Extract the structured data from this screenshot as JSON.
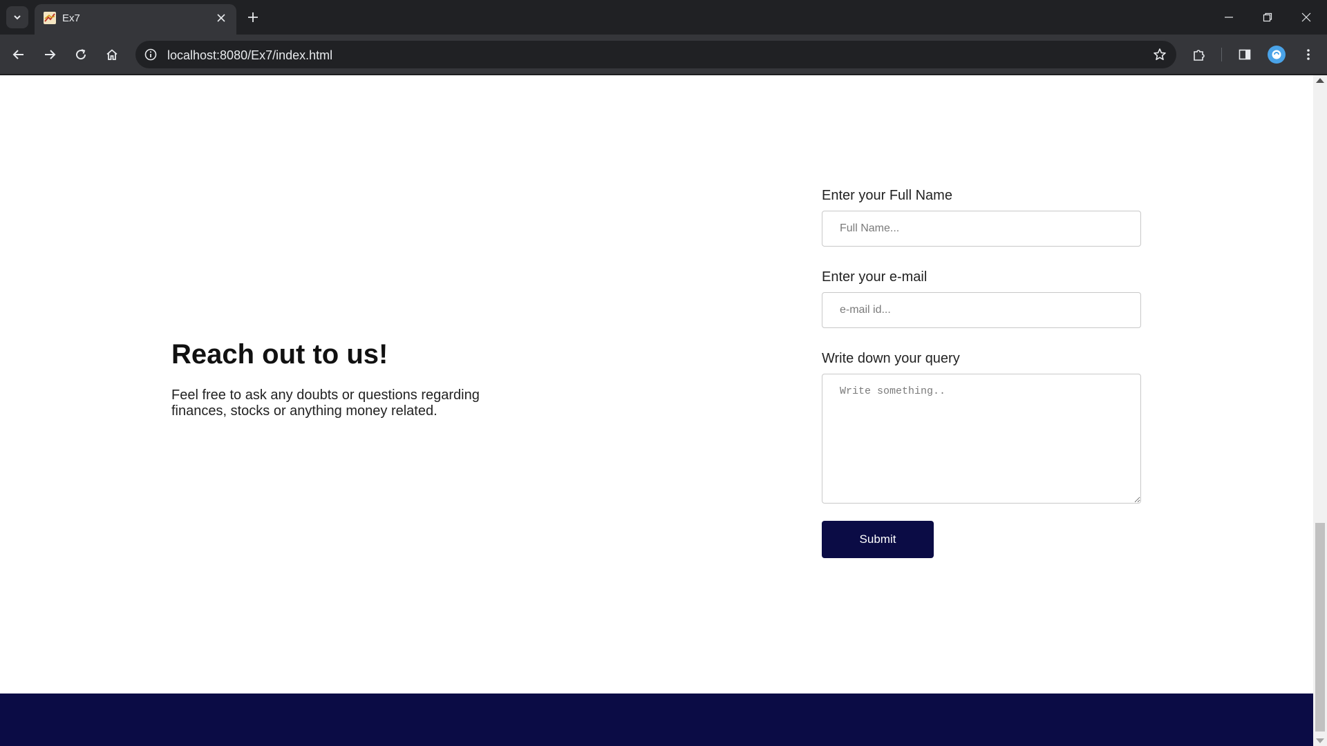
{
  "browser": {
    "tab_title": "Ex7",
    "url": "localhost:8080/Ex7/index.html"
  },
  "contact": {
    "heading": "Reach out to us!",
    "text": "Feel free to ask any doubts or questions regarding finances, stocks or anything money related."
  },
  "form": {
    "name_label": "Enter your Full Name",
    "name_placeholder": "Full Name...",
    "email_label": "Enter your e-mail",
    "email_placeholder": "e-mail id...",
    "query_label": "Write down your query",
    "query_placeholder": "Write something..",
    "submit_label": "Submit"
  },
  "colors": {
    "brand_navy": "#0b0c45",
    "chrome_dark": "#202124",
    "chrome_toolbar": "#35363a"
  },
  "icons": {
    "tab_search": "chevron-down-icon",
    "favicon": "favicon-icon",
    "close": "close-icon",
    "new_tab": "plus-icon",
    "back": "arrow-left-icon",
    "forward": "arrow-right-icon",
    "reload": "reload-icon",
    "home": "home-icon",
    "site_info": "info-icon",
    "bookmark": "star-icon",
    "extensions": "puzzle-icon",
    "side_panel": "side-panel-icon",
    "menu": "kebab-menu-icon"
  }
}
